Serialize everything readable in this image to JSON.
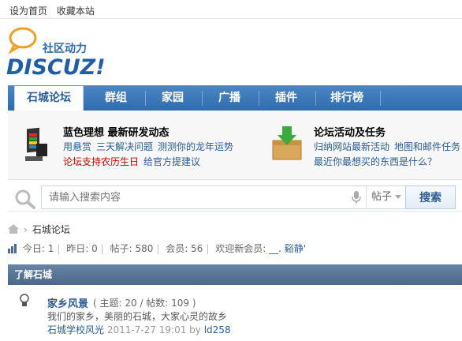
{
  "toplinks": {
    "set_home": "设为首页",
    "favorite": "收藏本站"
  },
  "logo": {
    "slogan": "社区动力",
    "wordmark": "DISCUZ!"
  },
  "nav": {
    "items": [
      {
        "label": "石城论坛"
      },
      {
        "label": "群组"
      },
      {
        "label": "家园"
      },
      {
        "label": "广播"
      },
      {
        "label": "插件"
      },
      {
        "label": "排行榜"
      }
    ]
  },
  "promo": {
    "left": {
      "title": "蓝色理想 最新研发动态",
      "line1": [
        "用悬赏",
        "三天解决问题",
        "测测你的龙年运势"
      ],
      "line2": [
        "论坛支持农历生日",
        "给官方提建议"
      ]
    },
    "right": {
      "title": "论坛活动及任务",
      "line1": [
        "归纳网站最新活动",
        "地图和邮件任务"
      ],
      "line2": [
        "最近你最想买的东西是什么？"
      ]
    }
  },
  "search": {
    "placeholder": "请输入搜索内容",
    "type": "帖子",
    "button": "搜索"
  },
  "breadcrumb": {
    "current": "石城论坛",
    "separator": "›"
  },
  "stats": {
    "today_label": "今日:",
    "today": "1",
    "yesterday_label": "昨日:",
    "yesterday": "0",
    "posts_label": "帖子:",
    "posts": "580",
    "members_label": "会员:",
    "members": "56",
    "newest_label": "欢迎新会员:",
    "newest": "__. 谿静'"
  },
  "section": {
    "title": "了解石城"
  },
  "forum": {
    "name": "家乡风景",
    "meta": "( 主题: 20 / 帖数: 109 )",
    "description": "我们的家乡，美丽的石城，大家心灵的故乡",
    "last_post_title": "石城学校风光",
    "last_post_time": "2011-7-27 19:01",
    "last_post_by": "by",
    "last_post_user": "ld258"
  },
  "colors": {
    "brand": "#2e6cae",
    "link": "#2b5c93",
    "alert": "#cc0000",
    "section": "#4f6d8f"
  }
}
